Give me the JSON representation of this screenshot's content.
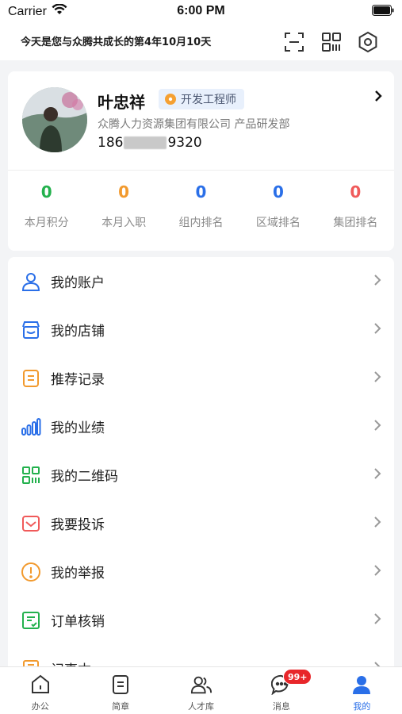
{
  "status_bar": {
    "carrier": "Carrier",
    "time": "6:00 PM"
  },
  "header": {
    "greeting": "今天是您与众腾共成长的第4年10月10天",
    "icons": [
      "scan-icon",
      "qrcode-icon",
      "settings-icon"
    ]
  },
  "profile": {
    "name": "叶忠祥",
    "title": "开发工程师",
    "company": "众腾人力资源集团有限公司 产品研发部",
    "phone_prefix": "186",
    "phone_suffix": "9320"
  },
  "stats": [
    {
      "value": "0",
      "label": "本月积分",
      "color": "#23b14d"
    },
    {
      "value": "0",
      "label": "本月入职",
      "color": "#f29a2e"
    },
    {
      "value": "0",
      "label": "组内排名",
      "color": "#2a6fe8"
    },
    {
      "value": "0",
      "label": "区域排名",
      "color": "#2a6fe8"
    },
    {
      "value": "0",
      "label": "集团排名",
      "color": "#f05a5a"
    }
  ],
  "menu": [
    {
      "label": "我的账户",
      "icon": "user-icon",
      "color": "#2a6fe8"
    },
    {
      "label": "我的店铺",
      "icon": "store-icon",
      "color": "#2a6fe8"
    },
    {
      "label": "推荐记录",
      "icon": "document-icon",
      "color": "#f29a2e"
    },
    {
      "label": "我的业绩",
      "icon": "bar-chart-icon",
      "color": "#2a6fe8"
    },
    {
      "label": "我的二维码",
      "icon": "qrcode-icon",
      "color": "#23b14d"
    },
    {
      "label": "我要投诉",
      "icon": "mail-icon",
      "color": "#f05a5a"
    },
    {
      "label": "我的举报",
      "icon": "alert-icon",
      "color": "#f29a2e"
    },
    {
      "label": "订单核销",
      "icon": "order-check-icon",
      "color": "#23b14d"
    },
    {
      "label": "记事本",
      "icon": "notebook-icon",
      "color": "#f29a2e"
    }
  ],
  "tabs": [
    {
      "label": "办公",
      "icon": "home-icon",
      "active": false
    },
    {
      "label": "简章",
      "icon": "brochure-icon",
      "active": false
    },
    {
      "label": "人才库",
      "icon": "talent-icon",
      "active": false
    },
    {
      "label": "消息",
      "icon": "message-icon",
      "active": false,
      "badge": "99+"
    },
    {
      "label": "我的",
      "icon": "profile-icon",
      "active": true
    }
  ]
}
